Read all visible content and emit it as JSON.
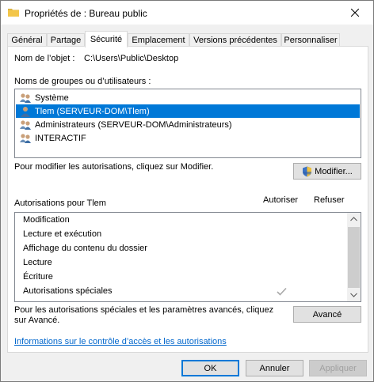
{
  "window": {
    "title": "Propriétés de : Bureau public"
  },
  "tabs": [
    {
      "label": "Général"
    },
    {
      "label": "Partage"
    },
    {
      "label": "Sécurité"
    },
    {
      "label": "Emplacement"
    },
    {
      "label": "Versions précédentes"
    },
    {
      "label": "Personnaliser"
    }
  ],
  "object": {
    "label": "Nom de l’objet :",
    "value": "C:\\Users\\Public\\Desktop"
  },
  "groups": {
    "label": "Noms de groupes ou d’utilisateurs :",
    "items": [
      {
        "label": "Système",
        "icon": "group-icon"
      },
      {
        "label": "Tlem (SERVEUR-DOM\\Tlem)",
        "icon": "user-icon"
      },
      {
        "label": "Administrateurs (SERVEUR-DOM\\Administrateurs)",
        "icon": "group-icon"
      },
      {
        "label": "INTERACTIF",
        "icon": "group-icon"
      }
    ],
    "selected_index": 1
  },
  "modify": {
    "hint": "Pour modifier les autorisations, cliquez sur Modifier.",
    "button_label": "Modifier..."
  },
  "permissions": {
    "label": "Autorisations pour Tlem",
    "allow_header": "Autoriser",
    "deny_header": "Refuser",
    "items": [
      {
        "label": "Modification",
        "allow": false
      },
      {
        "label": "Lecture et exécution",
        "allow": false
      },
      {
        "label": "Affichage du contenu du dossier",
        "allow": false
      },
      {
        "label": "Lecture",
        "allow": false
      },
      {
        "label": "Écriture",
        "allow": false
      },
      {
        "label": "Autorisations spéciales",
        "allow": true
      }
    ]
  },
  "advanced": {
    "hint": "Pour les autorisations spéciales et les paramètres avancés, cliquez sur Avancé.",
    "button_label": "Avancé"
  },
  "info_link": "Informations sur le contrôle d’accès et les autorisations",
  "footer": {
    "ok": "OK",
    "cancel": "Annuler",
    "apply": "Appliquer"
  },
  "colors": {
    "selection": "#0078d7",
    "link": "#0066cc",
    "folder": "#f3c64a"
  }
}
